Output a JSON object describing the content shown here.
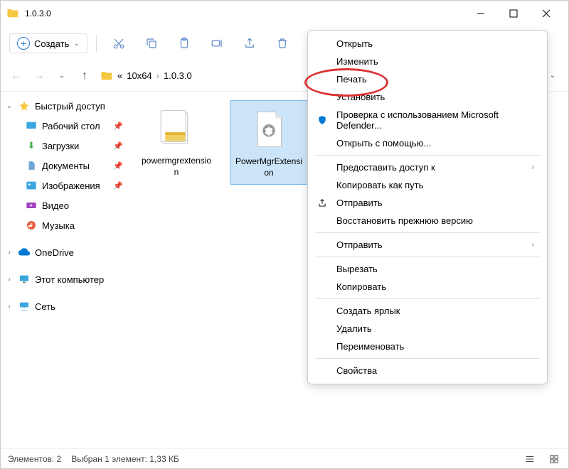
{
  "title": "1.0.3.0",
  "toolbar": {
    "create": "Создать"
  },
  "breadcrumb": {
    "prefix": "«",
    "p1": "10x64",
    "p2": "1.0.3.0"
  },
  "sidebar": {
    "quick": "Быстрый доступ",
    "desktop": "Рабочий стол",
    "downloads": "Загрузки",
    "documents": "Документы",
    "pictures": "Изображения",
    "video": "Видео",
    "music": "Музыка",
    "onedrive": "OneDrive",
    "thispc": "Этот компьютер",
    "network": "Сеть"
  },
  "files": {
    "f1": "powermgrextension",
    "f2": "PowerMgrExtension"
  },
  "status": {
    "count": "Элементов: 2",
    "sel": "Выбран 1 элемент: 1,33 КБ"
  },
  "menu": {
    "open": "Открыть",
    "edit": "Изменить",
    "print": "Печать",
    "install": "Установить",
    "defender": "Проверка с использованием Microsoft Defender...",
    "openwith": "Открыть с помощью...",
    "grantaccess": "Предоставить доступ к",
    "copypath": "Копировать как путь",
    "send": "Отправить",
    "restore": "Восстановить прежнюю версию",
    "sendto": "Отправить",
    "cut": "Вырезать",
    "copy": "Копировать",
    "shortcut": "Создать ярлык",
    "delete": "Удалить",
    "rename": "Переименовать",
    "props": "Свойства"
  }
}
